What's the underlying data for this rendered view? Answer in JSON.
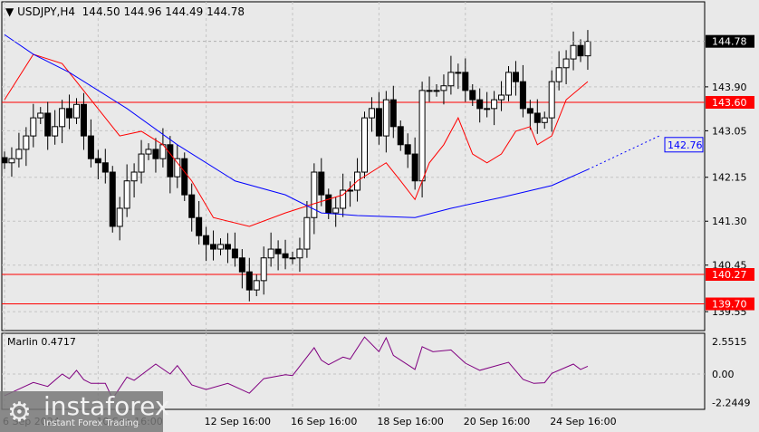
{
  "header": {
    "symbol": "USDJPY,H4",
    "ohlc": "144.50 144.96 144.49 144.78"
  },
  "indicator": {
    "label": "Marlin 0.4717",
    "ticks": [
      "2.5515",
      "0.00",
      "-2.2449"
    ]
  },
  "logo": {
    "name": "instaforex",
    "tagline": "Instant Forex Trading"
  },
  "colors": {
    "red": "#ff0000",
    "blue": "#0000ff",
    "marlin": "#800080"
  },
  "chart_data": {
    "type": "candlestick",
    "ylim": [
      139.45,
      145.25
    ],
    "y_ticks": [
      "143.90",
      "143.05",
      "142.15",
      "141.30",
      "140.45",
      "139.55"
    ],
    "tick_values": [
      143.9,
      143.05,
      142.15,
      141.3,
      140.45,
      139.55
    ],
    "x_labels": [
      "6 Sep 2024",
      "10 Sep 16:00",
      "12 Sep 16:00",
      "16 Sep 16:00",
      "18 Sep 16:00",
      "20 Sep 16:00",
      "24 Sep 16:00"
    ],
    "x_label_index": [
      0,
      13,
      28,
      40,
      52,
      64,
      76
    ],
    "closes": [
      142.43,
      142.51,
      142.69,
      142.95,
      143.3,
      143.39,
      142.95,
      143.13,
      143.48,
      143.3,
      143.56,
      142.95,
      142.51,
      142.43,
      142.25,
      141.2,
      141.55,
      142.08,
      142.25,
      142.6,
      142.69,
      142.51,
      142.78,
      142.16,
      142.51,
      141.81,
      141.37,
      141.02,
      140.85,
      140.76,
      140.85,
      140.76,
      140.59,
      140.32,
      139.97,
      140.15,
      140.59,
      140.76,
      140.67,
      140.59,
      140.59,
      140.76,
      141.37,
      142.25,
      141.81,
      141.46,
      141.55,
      141.9,
      141.9,
      142.25,
      143.3,
      143.48,
      142.95,
      143.65,
      143.13,
      142.78,
      142.6,
      142.08,
      143.83,
      143.83,
      143.83,
      143.92,
      144.18,
      144.18,
      143.83,
      143.65,
      143.48,
      143.48,
      143.65,
      143.74,
      144.18,
      144.0,
      143.48,
      143.39,
      143.21,
      143.3,
      144.0,
      144.27,
      144.44,
      144.7,
      144.5,
      144.78
    ],
    "current_price": "144.78",
    "levels": [
      {
        "label": "143.60",
        "value": 143.6
      },
      {
        "label": "140.27",
        "value": 140.27
      },
      {
        "label": "139.70",
        "value": 139.7
      }
    ],
    "red_ma": [
      [
        0,
        143.65
      ],
      [
        4,
        144.53
      ],
      [
        8,
        144.35
      ],
      [
        16,
        142.95
      ],
      [
        19,
        143.04
      ],
      [
        22,
        142.78
      ],
      [
        26,
        142.08
      ],
      [
        29,
        141.37
      ],
      [
        34,
        141.2
      ],
      [
        39,
        141.46
      ],
      [
        43,
        141.64
      ],
      [
        47,
        141.81
      ],
      [
        49,
        142.08
      ],
      [
        53,
        142.43
      ],
      [
        55,
        142.08
      ],
      [
        57,
        141.72
      ],
      [
        59,
        142.43
      ],
      [
        61,
        142.78
      ],
      [
        63,
        143.3
      ],
      [
        65,
        142.6
      ],
      [
        67,
        142.43
      ],
      [
        69,
        142.6
      ],
      [
        71,
        143.04
      ],
      [
        73,
        143.13
      ],
      [
        74,
        142.78
      ],
      [
        76,
        142.95
      ],
      [
        78,
        143.65
      ],
      [
        81,
        144.0
      ]
    ],
    "blue_ma": [
      [
        0,
        144.91
      ],
      [
        4,
        144.53
      ],
      [
        9,
        144.18
      ],
      [
        17,
        143.48
      ],
      [
        24,
        142.78
      ],
      [
        32,
        142.08
      ],
      [
        39,
        141.81
      ],
      [
        44,
        141.46
      ],
      [
        49,
        141.41
      ],
      [
        57,
        141.37
      ],
      [
        62,
        141.55
      ],
      [
        69,
        141.76
      ],
      [
        76,
        141.99
      ],
      [
        81,
        142.3
      ]
    ],
    "blue_projection": {
      "to_index": 91,
      "value": 142.78,
      "label": "142.76"
    },
    "marlin": {
      "ylim": [
        -2.2449,
        2.5515
      ],
      "points": [
        [
          0,
          -1.7
        ],
        [
          4,
          -0.66
        ],
        [
          6,
          -0.97
        ],
        [
          8,
          0
        ],
        [
          9,
          -0.36
        ],
        [
          10,
          0.29
        ],
        [
          11,
          -0.44
        ],
        [
          12,
          -0.73
        ],
        [
          14,
          -0.73
        ],
        [
          15,
          -1.94
        ],
        [
          17,
          -0.24
        ],
        [
          18,
          -0.49
        ],
        [
          21,
          0.78
        ],
        [
          23,
          0
        ],
        [
          24,
          0.66
        ],
        [
          26,
          -0.85
        ],
        [
          28,
          -1.21
        ],
        [
          31,
          -0.73
        ],
        [
          34,
          -1.5
        ],
        [
          36,
          -0.36
        ],
        [
          39,
          -0.05
        ],
        [
          40,
          -0.12
        ],
        [
          43,
          2.06
        ],
        [
          44,
          1.09
        ],
        [
          45,
          0.73
        ],
        [
          47,
          1.33
        ],
        [
          48,
          1.17
        ],
        [
          50,
          2.9
        ],
        [
          52,
          1.75
        ],
        [
          53,
          2.84
        ],
        [
          54,
          1.46
        ],
        [
          57,
          0.36
        ],
        [
          58,
          2.14
        ],
        [
          59.5,
          1.75
        ],
        [
          62,
          1.89
        ],
        [
          64,
          0.85
        ],
        [
          66,
          0.29
        ],
        [
          70,
          0.92
        ],
        [
          72,
          -0.41
        ],
        [
          73.5,
          -0.73
        ],
        [
          75,
          -0.68
        ],
        [
          76,
          0.05
        ],
        [
          79,
          0.78
        ],
        [
          80,
          0.36
        ],
        [
          81,
          0.61
        ]
      ]
    }
  }
}
